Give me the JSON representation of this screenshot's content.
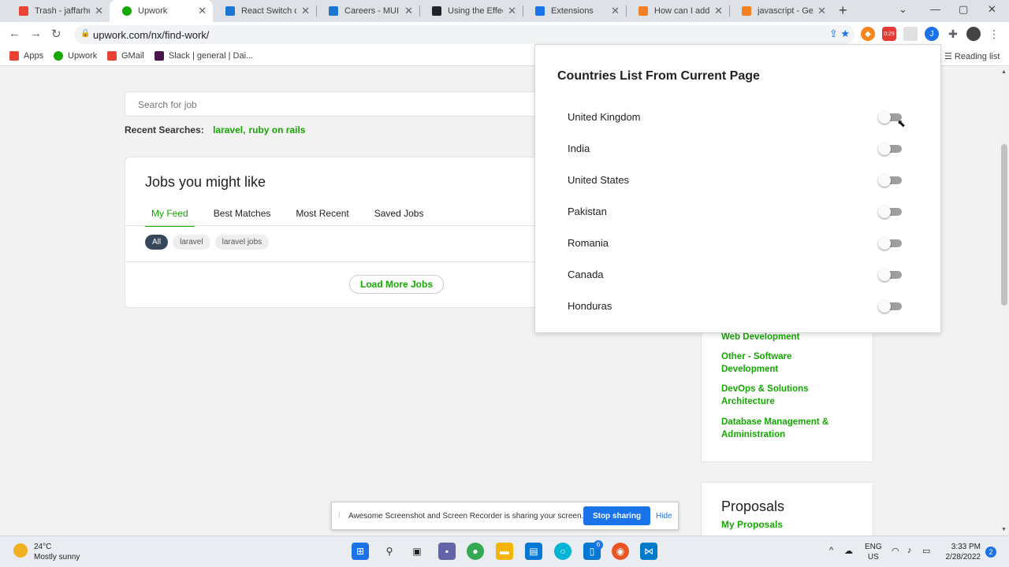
{
  "browser": {
    "tabs": [
      {
        "title": "Trash - jaffarhussa",
        "favicon_color": "#ea4335",
        "active": false
      },
      {
        "title": "Upwork",
        "favicon_color": "#14a800",
        "active": true
      },
      {
        "title": "React Switch com",
        "favicon_color": "#1976d2",
        "active": false
      },
      {
        "title": "Careers - MUI",
        "favicon_color": "#1976d2",
        "active": false
      },
      {
        "title": "Using the Effect H",
        "favicon_color": "#20232a",
        "active": false
      },
      {
        "title": "Extensions",
        "favicon_color": "#1a73e8",
        "active": false
      },
      {
        "title": "How can I add a l",
        "favicon_color": "#f48024",
        "active": false
      },
      {
        "title": "javascript - Gettin",
        "favicon_color": "#f48024",
        "active": false
      }
    ],
    "url": "upwork.com/nx/find-work/",
    "extension_badge": "0:29",
    "bookmarks": [
      {
        "label": "Apps",
        "icon_color": "#ea4335"
      },
      {
        "label": "Upwork",
        "icon_color": "#14a800"
      },
      {
        "label": "GMail",
        "icon_color": "#ea4335"
      },
      {
        "label": "Slack | general | Dai...",
        "icon_color": "#4a154b"
      }
    ],
    "reading_list": "Reading list"
  },
  "page": {
    "search_placeholder": "Search for job",
    "recent_label": "Recent Searches:",
    "recent_searches": [
      "laravel,",
      "ruby on rails"
    ],
    "jobs_title": "Jobs you might like",
    "jobs_tabs": [
      "My Feed",
      "Best Matches",
      "Most Recent",
      "Saved Jobs"
    ],
    "chips": [
      "All",
      "laravel",
      "laravel jobs"
    ],
    "load_more": "Load More Jobs",
    "categories": [
      "Web Development",
      "Other - Software Development",
      "DevOps & Solutions Architecture",
      "Database Management & Administration"
    ],
    "proposals_title": "Proposals",
    "my_proposals": "My Proposals"
  },
  "popup": {
    "title": "Countries List From Current Page",
    "countries": [
      {
        "name": "United Kingdom",
        "enabled": false
      },
      {
        "name": "India",
        "enabled": false
      },
      {
        "name": "United States",
        "enabled": false
      },
      {
        "name": "Pakistan",
        "enabled": false
      },
      {
        "name": "Romania",
        "enabled": false
      },
      {
        "name": "Canada",
        "enabled": false
      },
      {
        "name": "Honduras",
        "enabled": false
      }
    ]
  },
  "share_banner": {
    "message": "Awesome Screenshot and Screen Recorder is sharing your screen.",
    "stop_label": "Stop sharing",
    "hide_label": "Hide"
  },
  "taskbar": {
    "temperature": "24°C",
    "weather": "Mostly sunny",
    "lang_top": "ENG",
    "lang_bottom": "US",
    "time": "3:33 PM",
    "date": "2/28/2022",
    "notification_count": "2",
    "store_badge": "6"
  }
}
